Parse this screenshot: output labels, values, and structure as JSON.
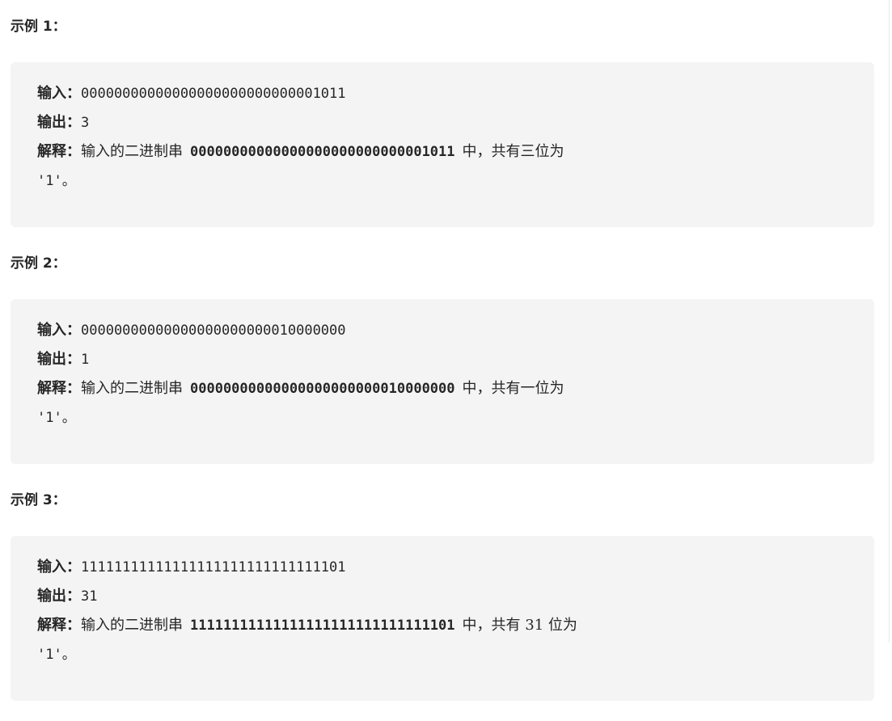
{
  "examples": [
    {
      "heading": "示例 1：",
      "input_label": "输入：",
      "input_value": "00000000000000000000000000001011",
      "output_label": "输出：",
      "output_value": "3",
      "explanation_label": "解释：",
      "explanation_prefix": "输入的二进制串",
      "explanation_bold": "00000000000000000000000000001011",
      "explanation_suffix": "中，共有三位为",
      "explanation_tail": "'1'。"
    },
    {
      "heading": "示例 2：",
      "input_label": "输入：",
      "input_value": "00000000000000000000000010000000",
      "output_label": "输出：",
      "output_value": "1",
      "explanation_label": "解释：",
      "explanation_prefix": "输入的二进制串",
      "explanation_bold": "00000000000000000000000010000000",
      "explanation_suffix": "中，共有一位为",
      "explanation_tail": "'1'。"
    },
    {
      "heading": "示例 3：",
      "input_label": "输入：",
      "input_value": "11111111111111111111111111111101",
      "output_label": "输出：",
      "output_value": "31",
      "explanation_label": "解释：",
      "explanation_prefix": "输入的二进制串",
      "explanation_bold": "11111111111111111111111111111101",
      "explanation_suffix": "中，共有 31 位为",
      "explanation_tail": "'1'。"
    }
  ]
}
